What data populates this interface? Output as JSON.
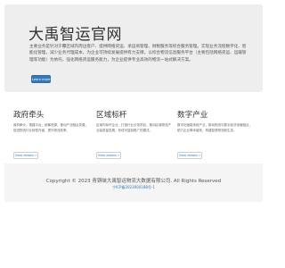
{
  "hero": {
    "title": "大禹智运官网",
    "text": "主要业务是针对于覆区域内周边客户、提供网络货运、承运商管理、财税服务等综合服务管理。实现业务流程数字化、智能化管理，减少业务代理成本，为企业可持续发展提供有力支撑。以综合物流信息服务平台（主要包括网络货运、运输管理等功能）为依托，强化网络货运服务能力，为企业提供专业高效的物流一站式解决方案。",
    "button_label": "Learn more"
  },
  "columns": [
    {
      "title": "政府牵头",
      "text": "政府牵头，搭建平台，统筹资源，推动产业融合发展，促进物流行业转型升级，提升物流效率。",
      "button_label": "View details »"
    },
    {
      "title": "区域标杆",
      "text": "区域内标杆企业，打造行业示范项目，推动区域物流产业高质量发展，形成可复制推广的模式。",
      "button_label": "View details »"
    },
    {
      "title": "数字产业",
      "text": "数字化赋能传统产业，推动物流与数字经济深度融合，助力企业降本增效，构建智慧物流新生态。",
      "button_label": "View details »"
    }
  ],
  "footer": {
    "copyright": "Copyright © 2023 青铜峡大禹智运物流大数据有限公司. All Rights Reserved",
    "icp": "宁ICP备2023000188号-1"
  },
  "colors": {
    "primary": "#337ab7",
    "hero_bg": "#eeeeee",
    "footer_bg": "#f5f5f5"
  }
}
